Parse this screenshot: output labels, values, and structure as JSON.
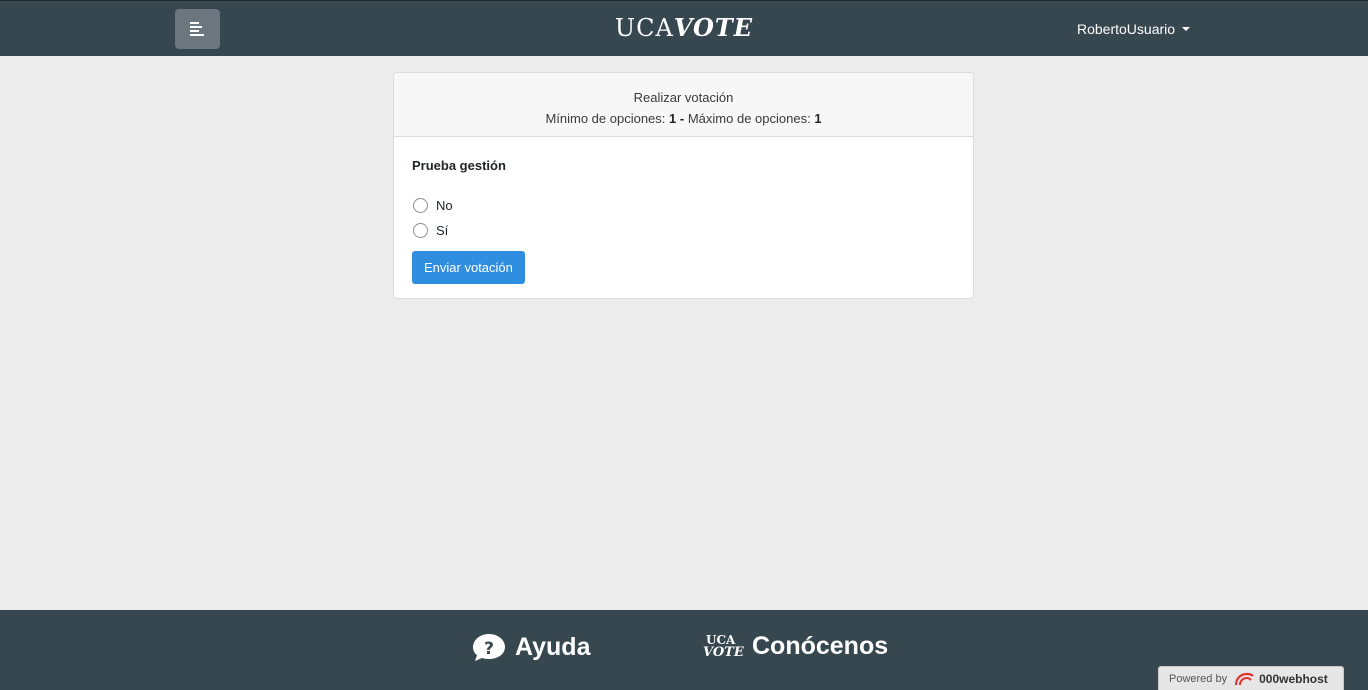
{
  "header": {
    "brand_part1": "UCA",
    "brand_part2": "VOTE",
    "user_name": "RobertoUsuario"
  },
  "vote_card": {
    "title": "Realizar votación",
    "min_label": "Mínimo de opciones:",
    "min_value": "1",
    "separator": "-",
    "max_label": "Máximo de opciones:",
    "max_value": "1",
    "question": "Prueba gestión",
    "options": [
      "No",
      "Sí"
    ],
    "submit_label": "Enviar votación"
  },
  "footer": {
    "help_label": "Ayuda",
    "about_logo_top": "UCA",
    "about_logo_bottom": "VOTE",
    "about_label": "Conócenos"
  },
  "powered_badge": {
    "prefix": "Powered by",
    "host": "000webhost"
  },
  "colors": {
    "navbar": "#36474f",
    "accent_button": "#2f8ee0",
    "page_background": "#ececec"
  }
}
